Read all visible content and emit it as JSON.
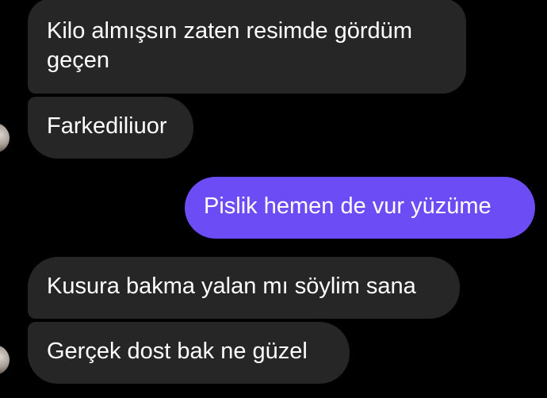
{
  "messages": [
    {
      "id": "m1",
      "direction": "incoming",
      "text": "Kilo almışsın zaten resimde gördüm geçen"
    },
    {
      "id": "m2",
      "direction": "incoming",
      "text": "Farkediliuor"
    },
    {
      "id": "m3",
      "direction": "outgoing",
      "text": "Pislik hemen de vur yüzüme"
    },
    {
      "id": "m4",
      "direction": "incoming",
      "text": "Kusura bakma yalan mı söylim sana"
    },
    {
      "id": "m5",
      "direction": "incoming",
      "text": "Gerçek dost bak ne güzel"
    }
  ],
  "colors": {
    "background": "#000000",
    "incoming_bubble": "#262626",
    "outgoing_bubble": "#6c4df5",
    "text": "#ffffff"
  }
}
